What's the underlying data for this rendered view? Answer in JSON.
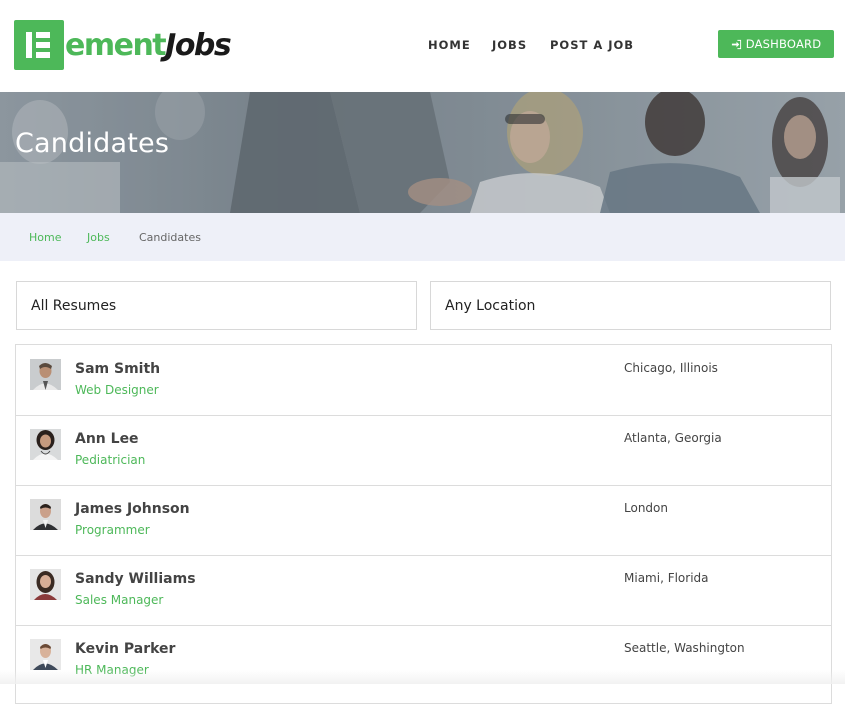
{
  "brand": {
    "logo_part1": "ement",
    "logo_part2": "Jobs",
    "accent": "#4db859"
  },
  "nav": {
    "home": "HOME",
    "jobs": "JOBS",
    "post_job": "POST A JOB",
    "dashboard": "DASHBOARD"
  },
  "hero": {
    "title": "Candidates"
  },
  "breadcrumb": {
    "home": "Home",
    "jobs": "Jobs",
    "current": "Candidates"
  },
  "filters": {
    "resumes": "All Resumes",
    "location": "Any Location"
  },
  "candidates": [
    {
      "name": "Sam Smith",
      "title": "Web Designer",
      "location": "Chicago, Illinois"
    },
    {
      "name": "Ann Lee",
      "title": "Pediatrician",
      "location": "Atlanta, Georgia"
    },
    {
      "name": "James Johnson",
      "title": "Programmer",
      "location": "London"
    },
    {
      "name": "Sandy Williams",
      "title": "Sales Manager",
      "location": "Miami, Florida"
    },
    {
      "name": "Kevin Parker",
      "title": "HR Manager",
      "location": "Seattle, Washington"
    }
  ]
}
